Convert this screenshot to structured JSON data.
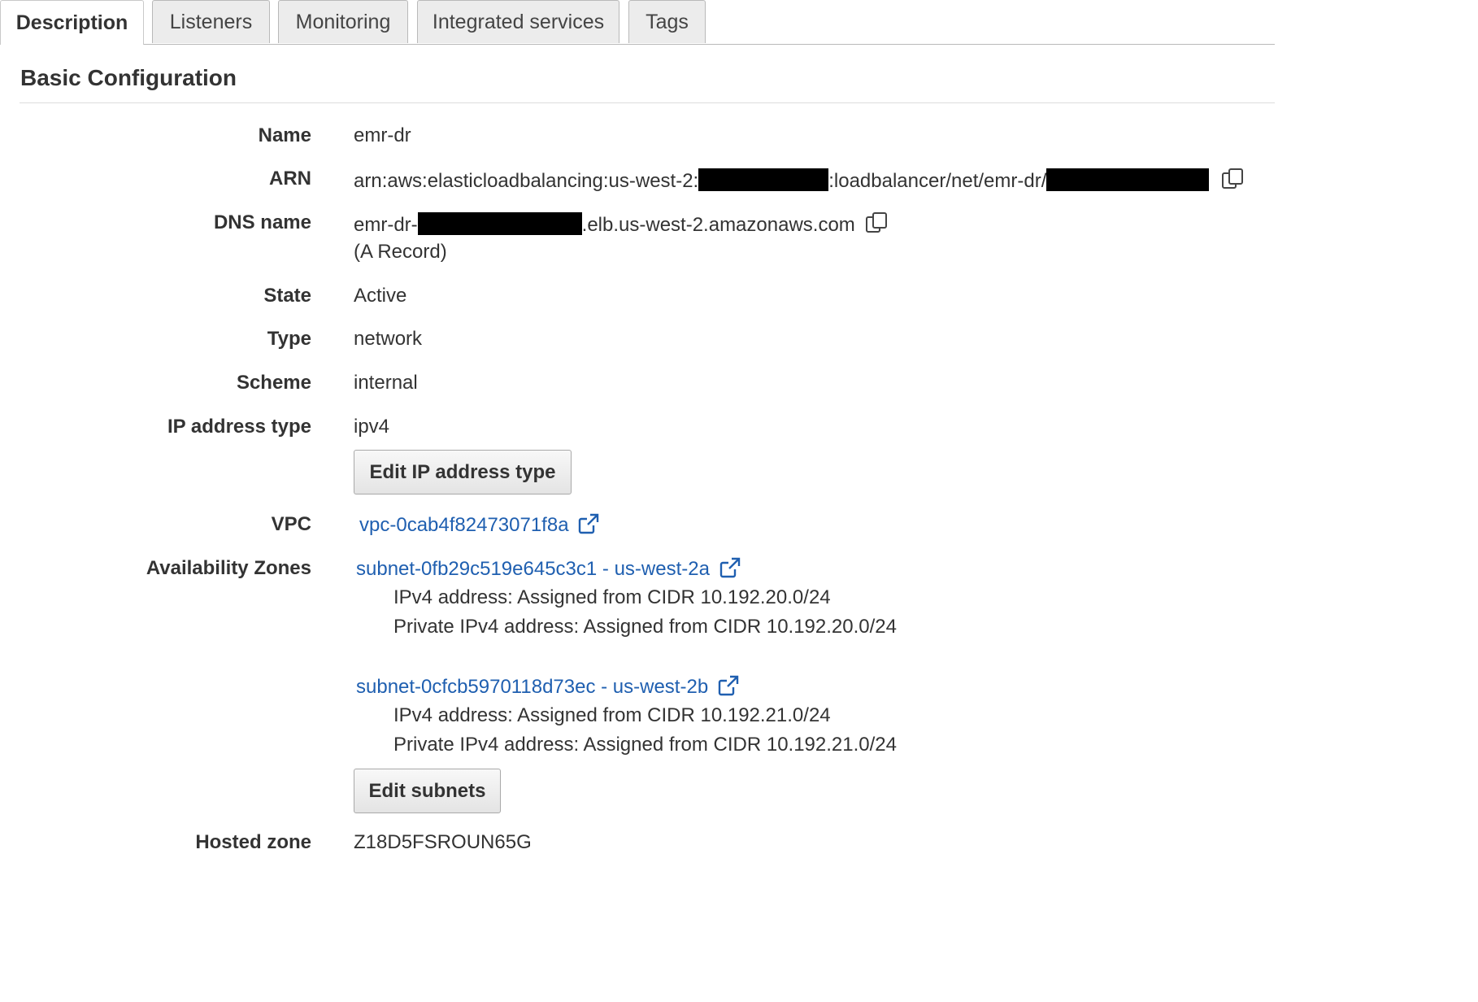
{
  "tabs": [
    {
      "label": "Description",
      "active": true
    },
    {
      "label": "Listeners",
      "active": false
    },
    {
      "label": "Monitoring",
      "active": false
    },
    {
      "label": "Integrated services",
      "active": false
    },
    {
      "label": "Tags",
      "active": false
    }
  ],
  "section": {
    "title": "Basic Configuration"
  },
  "fields": {
    "name": {
      "label": "Name",
      "value": "emr-dr"
    },
    "arn": {
      "label": "ARN",
      "prefix": "arn:aws:elasticloadbalancing:us-west-2:",
      "middle": ":loadbalancer/net/emr-dr/"
    },
    "dns": {
      "label": "DNS name",
      "prefix": "emr-dr-",
      "suffix": ".elb.us-west-2.amazonaws.com",
      "record": "(A Record)"
    },
    "state": {
      "label": "State",
      "value": "Active"
    },
    "type": {
      "label": "Type",
      "value": "network"
    },
    "scheme": {
      "label": "Scheme",
      "value": "internal"
    },
    "ip_type": {
      "label": "IP address type",
      "value": "ipv4",
      "button": "Edit IP address type"
    },
    "vpc": {
      "label": "VPC",
      "value": "vpc-0cab4f82473071f8a"
    },
    "az": {
      "label": "Availability Zones",
      "subnets": [
        {
          "link": "subnet-0fb29c519e645c3c1 - us-west-2a",
          "ipv4": "IPv4 address: Assigned from CIDR 10.192.20.0/24",
          "private": "Private IPv4 address: Assigned from CIDR 10.192.20.0/24"
        },
        {
          "link": "subnet-0cfcb5970118d73ec - us-west-2b",
          "ipv4": "IPv4 address: Assigned from CIDR 10.192.21.0/24",
          "private": "Private IPv4 address: Assigned from CIDR 10.192.21.0/24"
        }
      ],
      "button": "Edit subnets"
    },
    "hosted_zone": {
      "label": "Hosted zone",
      "value": "Z18D5FSROUN65G"
    }
  },
  "icons": {
    "copy": "copy-icon",
    "external": "external-link-icon"
  },
  "colors": {
    "link": "#1f5fb0",
    "redaction": "#000000"
  }
}
